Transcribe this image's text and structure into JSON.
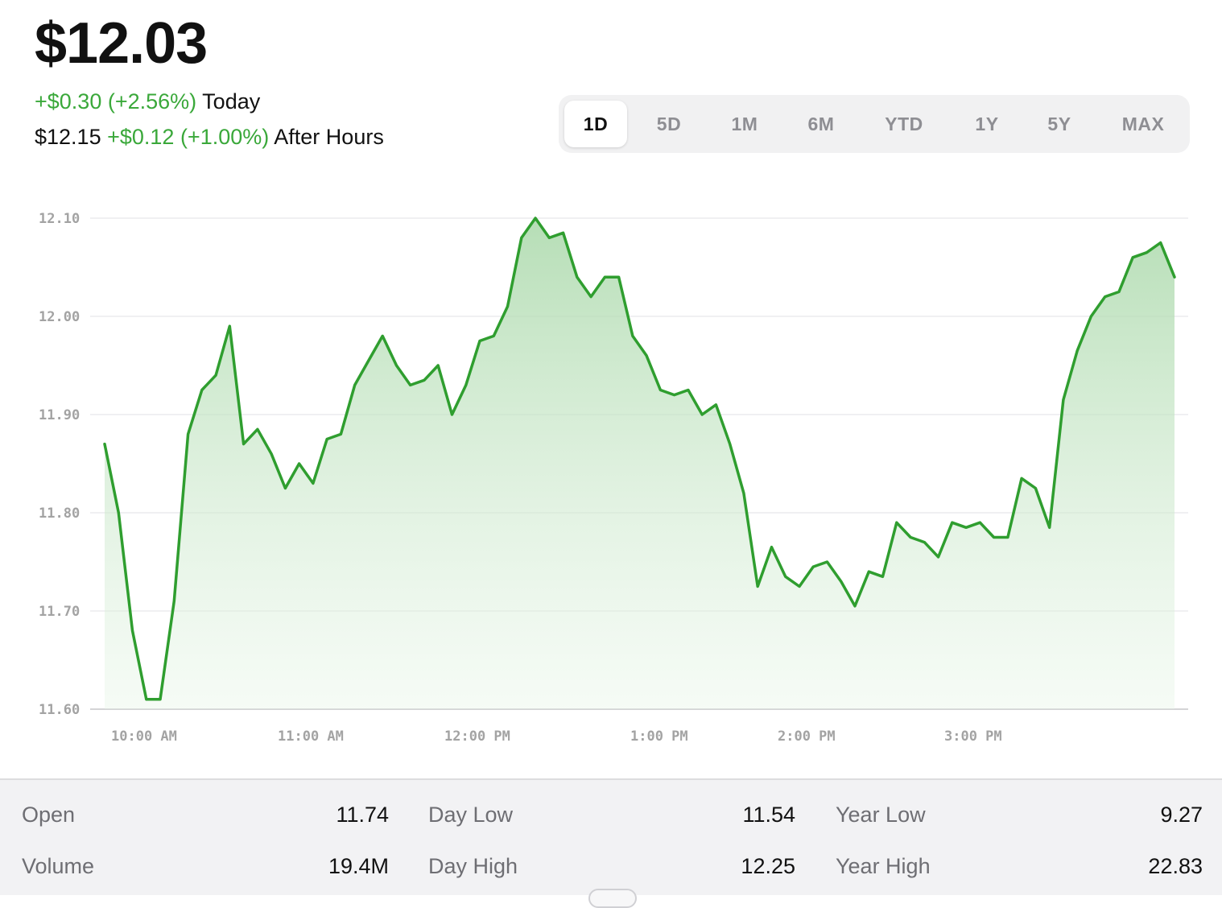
{
  "header": {
    "price": "$12.03",
    "change": "+$0.30 (+2.56%)",
    "change_period": "Today",
    "after_hours_price": "$12.15",
    "after_hours_change": "+$0.12 (+1.00%)",
    "after_hours_label": "After Hours"
  },
  "ranges": {
    "items": [
      "1D",
      "5D",
      "1M",
      "6M",
      "YTD",
      "1Y",
      "5Y",
      "MAX"
    ],
    "selected": "1D"
  },
  "colors": {
    "positive": "#3aa83a",
    "line": "#2f9e2f",
    "fill": "#bfe3bf"
  },
  "chart_data": {
    "type": "area",
    "x_ticks": [
      "10:00 AM",
      "11:00 AM",
      "12:00 PM",
      "1:00 PM",
      "2:00 PM",
      "3:00 PM"
    ],
    "y_ticks": [
      "12.10",
      "12.00",
      "11.90",
      "11.80",
      "11.70",
      "11.60"
    ],
    "ylim": [
      11.6,
      12.1
    ],
    "x_range_minutes": [
      "09:30",
      "16:00"
    ],
    "grid": true,
    "series": [
      {
        "values": [
          11.87,
          11.8,
          11.68,
          11.61,
          11.61,
          11.71,
          11.88,
          11.925,
          11.94,
          11.99,
          11.87,
          11.885,
          11.86,
          11.825,
          11.85,
          11.83,
          11.875,
          11.88,
          11.93,
          11.955,
          11.98,
          11.95,
          11.93,
          11.935,
          11.95,
          11.9,
          11.93,
          11.975,
          11.98,
          12.01,
          12.08,
          12.1,
          12.08,
          12.085,
          12.04,
          12.02,
          12.04,
          12.04,
          11.98,
          11.96,
          11.925,
          11.92,
          11.925,
          11.9,
          11.91,
          11.87,
          11.82,
          11.725,
          11.765,
          11.735,
          11.725,
          11.745,
          11.75,
          11.73,
          11.705,
          11.74,
          11.735,
          11.79,
          11.775,
          11.77,
          11.755,
          11.79,
          11.785,
          11.79,
          11.775,
          11.775,
          11.835,
          11.825,
          11.785,
          11.915,
          11.965,
          12.0,
          12.02,
          12.025,
          12.06,
          12.065,
          12.075,
          12.04
        ]
      }
    ]
  },
  "stats": {
    "open_label": "Open",
    "open_value": "11.74",
    "volume_label": "Volume",
    "volume_value": "19.4M",
    "day_low_label": "Day Low",
    "day_low_value": "11.54",
    "day_high_label": "Day High",
    "day_high_value": "12.25",
    "year_low_label": "Year Low",
    "year_low_value": "9.27",
    "year_high_label": "Year High",
    "year_high_value": "22.83"
  }
}
